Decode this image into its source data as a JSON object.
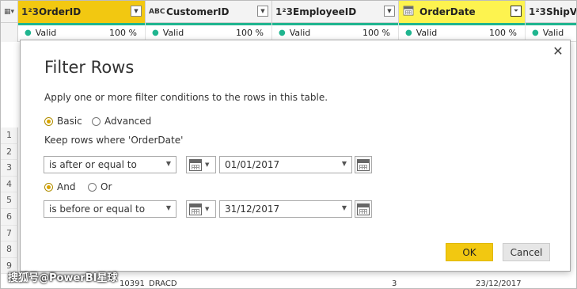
{
  "grid": {
    "corner_icon": "table-icon",
    "columns": [
      {
        "type": "1²3",
        "name": "OrderID",
        "filtered": false
      },
      {
        "type": "ABC",
        "name": "CustomerID",
        "filtered": false
      },
      {
        "type": "1²3",
        "name": "EmployeeID",
        "filtered": false
      },
      {
        "type": "calendar",
        "name": "OrderDate",
        "filtered": true
      },
      {
        "type": "1²3",
        "name": "ShipVia",
        "filtered": false
      }
    ],
    "quality": [
      {
        "label": "Valid",
        "pct": "100 %"
      },
      {
        "label": "Valid",
        "pct": "100 %"
      },
      {
        "label": "Valid",
        "pct": "100 %"
      },
      {
        "label": "Valid",
        "pct": "100 %"
      },
      {
        "label": "Valid",
        "pct": ""
      }
    ],
    "row_numbers": [
      "1",
      "2",
      "3",
      "4",
      "5",
      "6",
      "7",
      "8",
      "9"
    ],
    "last_row": {
      "order_id": "10391",
      "customer": "DRACD",
      "employee": "3",
      "date": "23/12/2017"
    }
  },
  "watermark": "搜狐号@PowerBI星球",
  "dialog": {
    "title": "Filter Rows",
    "description": "Apply one or more filter conditions to the rows in this table.",
    "mode_basic": "Basic",
    "mode_advanced": "Advanced",
    "keep_label": "Keep rows where 'OrderDate'",
    "condition1": {
      "operator": "is after or equal to",
      "value": "01/01/2017"
    },
    "logic_and": "And",
    "logic_or": "Or",
    "condition2": {
      "operator": "is before or equal to",
      "value": "31/12/2017"
    },
    "ok_label": "OK",
    "cancel_label": "Cancel"
  },
  "colors": {
    "accent": "#f2c811",
    "quality_bar": "#1fb58f",
    "filtered_header": "#fdf34f"
  }
}
